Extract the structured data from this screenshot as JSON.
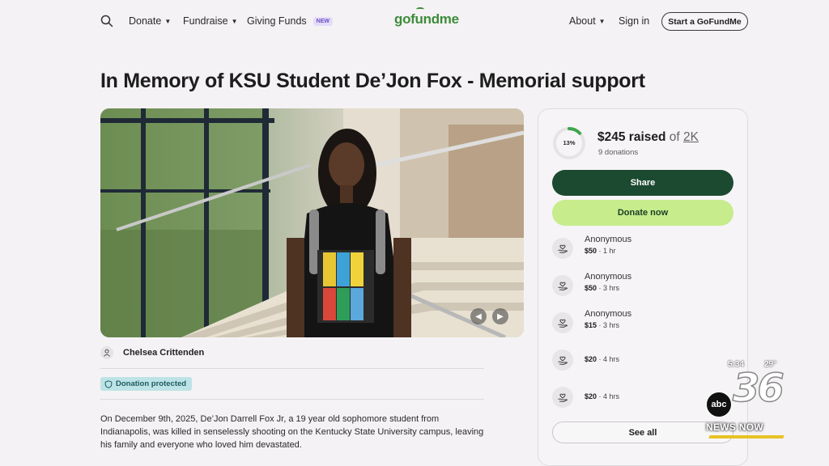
{
  "header": {
    "nav_left": [
      {
        "label": "Donate",
        "has_caret": true
      },
      {
        "label": "Fundraise",
        "has_caret": true
      },
      {
        "label": "Giving Funds",
        "badge": "NEW"
      }
    ],
    "logo": "gofundme",
    "nav_right": [
      {
        "label": "About",
        "has_caret": true
      },
      {
        "label": "Sign in"
      }
    ],
    "start_button": "Start a GoFundMe"
  },
  "campaign": {
    "title": "In Memory of KSU Student De’Jon Fox - Memorial support",
    "organizer": "Chelsea Crittenden",
    "protected_label": "Donation protected",
    "story": "On December 9th, 2025, De’Jon Darrell Fox Jr, a 19 year old sophomore student from Indianapolis, was killed in senselessly shooting on the Kentucky State University campus, leaving his family and everyone who loved him devastated."
  },
  "progress": {
    "percent_label": "13%",
    "percent_value": 13,
    "raised": "$245 raised",
    "of_text": "of",
    "goal": "2K",
    "donations": "9 donations"
  },
  "buttons": {
    "share": "Share",
    "donate": "Donate now",
    "see_all": "See all"
  },
  "donors": [
    {
      "name": "Anonymous",
      "amount": "$50",
      "time": "1 hr"
    },
    {
      "name": "Anonymous",
      "amount": "$50",
      "time": "3 hrs"
    },
    {
      "name": "Anonymous",
      "amount": "$15",
      "time": "3 hrs"
    },
    {
      "name": "",
      "amount": "$20",
      "time": "4 hrs"
    },
    {
      "name": "",
      "amount": "$20",
      "time": "4 hrs"
    }
  ],
  "tv_overlay": {
    "time": "5:34",
    "temp": "29°",
    "channel": "36",
    "network": "abc",
    "brand": "NEWS NOW"
  },
  "colors": {
    "share_green": "#1c4a31",
    "donate_lime": "#c6ec8c",
    "logo_green": "#3d8c3a",
    "protected_bg": "#bde3e6"
  }
}
